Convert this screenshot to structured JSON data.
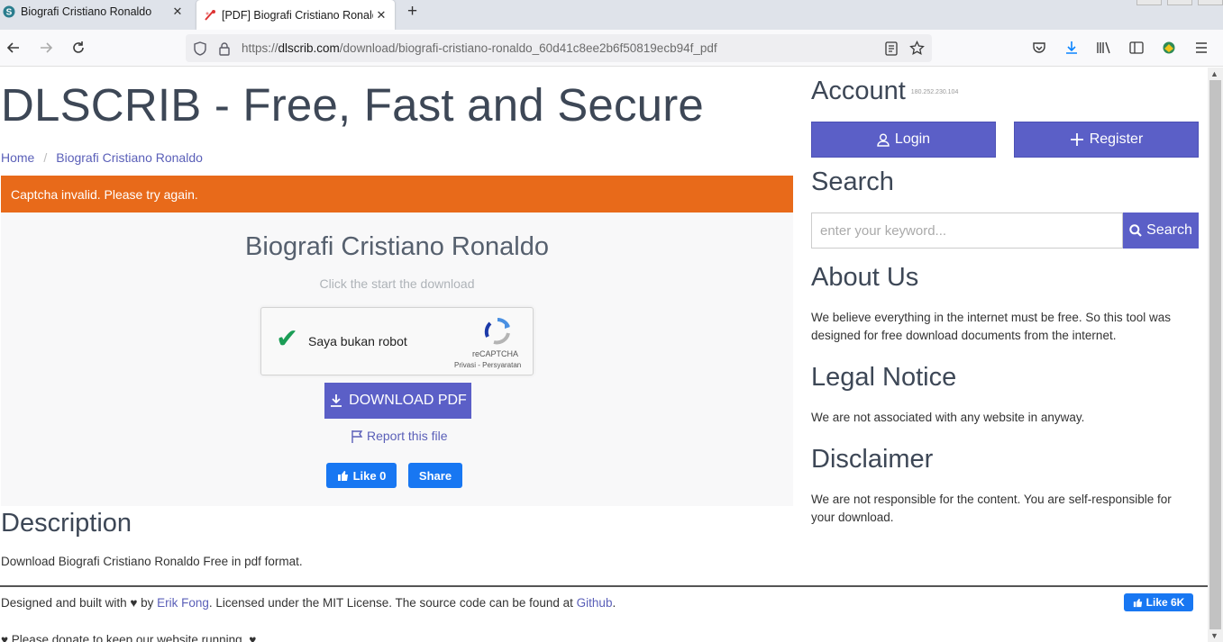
{
  "browser": {
    "tabs": [
      {
        "title": "Biografi Cristiano Ronaldo",
        "active": false
      },
      {
        "title": "[PDF] Biografi Cristiano Ronaldo",
        "active": true
      }
    ],
    "url_prefix": "https://",
    "url_domain": "dlscrib.com",
    "url_path": "/download/biografi-cristiano-ronaldo_60d41c8ee2b6f50819ecb94f_pdf"
  },
  "header": {
    "brand": "DLSCRIB - Free, Fast and Secure",
    "breadcrumb": {
      "home": "Home",
      "current": "Biografi Cristiano Ronaldo"
    }
  },
  "alert": {
    "text": "Captcha invalid. Please try again.",
    "color": "#e86a1a"
  },
  "download_card": {
    "title": "Biografi Cristiano Ronaldo",
    "subtitle": "Click the start the download",
    "captcha": {
      "label": "Saya bukan robot",
      "brand": "reCAPTCHA",
      "links": "Privasi - Persyaratan"
    },
    "download_label": "DOWNLOAD PDF",
    "report_label": "Report this file",
    "fb_like": "Like 0",
    "fb_share": "Share"
  },
  "description": {
    "heading": "Description",
    "text": "Download Biografi Cristiano Ronaldo Free in pdf format."
  },
  "footer": {
    "pre": "Designed and built with ♥ by ",
    "author": "Erik Fong",
    "mid": ". Licensed under the MIT License. The source code can be found at ",
    "github": "Github",
    "post": ".",
    "fb_like": "Like 6K",
    "donate": "♥ Please donate to keep our website running. ♥"
  },
  "sidebar": {
    "account_heading": "Account",
    "ip": "180.252.230.104",
    "login_label": "Login",
    "register_label": "Register",
    "search_heading": "Search",
    "search_placeholder": "enter your keyword...",
    "search_button": "Search",
    "about_heading": "About Us",
    "about_text": "We believe everything in the internet must be free. So this tool was designed for free download documents from the internet.",
    "legal_heading": "Legal Notice",
    "legal_text": "We are not associated with any website in anyway.",
    "disclaimer_heading": "Disclaimer",
    "disclaimer_text": "We are not responsible for the content. You are self-responsible for your download."
  },
  "colors": {
    "accent": "#5b5fc7",
    "facebook": "#1877f2",
    "link": "#5a5fb8"
  }
}
